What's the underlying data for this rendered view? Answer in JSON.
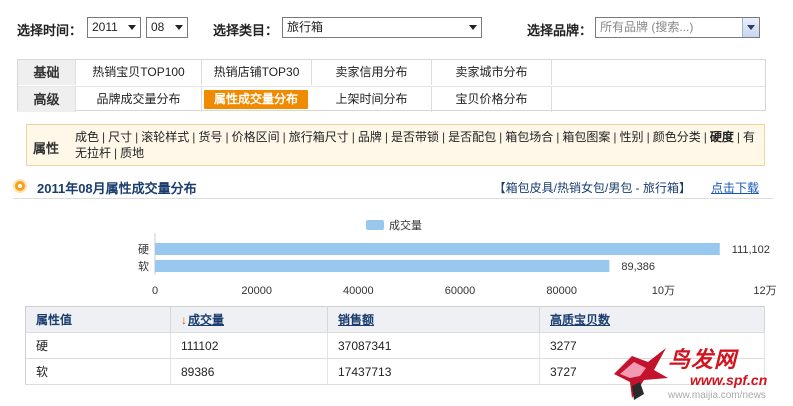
{
  "filters": {
    "time_label": "选择时间：",
    "year": "2011",
    "month": "08",
    "category_label": "选择类目：",
    "category": "旅行箱",
    "brand_label": "选择品牌：",
    "brand_placeholder": "所有品牌 (搜索...)"
  },
  "nav": {
    "basic_label": "基础",
    "basic_items": [
      "热销宝贝TOP100",
      "热销店铺TOP30",
      "卖家信用分布",
      "卖家城市分布"
    ],
    "advanced_label": "高级",
    "advanced_items": [
      "品牌成交量分布",
      "属性成交量分布",
      "上架时间分布",
      "宝贝价格分布"
    ],
    "active_advanced_index": 1
  },
  "attributes": {
    "label": "属性",
    "items": [
      "成色",
      "尺寸",
      "滚轮样式",
      "货号",
      "价格区间",
      "旅行箱尺寸",
      "品牌",
      "是否带锁",
      "是否配包",
      "箱包场合",
      "箱包图案",
      "性别",
      "颜色分类",
      "硬度",
      "有无拉杆",
      "质地"
    ],
    "current": "硬度"
  },
  "section": {
    "title": "2011年08月属性成交量分布",
    "category_path": "【箱包皮具/热销女包/男包 - 旅行箱】",
    "download_link": "点击下载"
  },
  "chart_data": {
    "type": "bar",
    "orientation": "horizontal",
    "categories": [
      "硬",
      "软"
    ],
    "series": [
      {
        "name": "成交量",
        "values": [
          111102,
          89386
        ]
      }
    ],
    "data_labels": [
      "111,102",
      "89,386"
    ],
    "xlim": [
      0,
      120000
    ],
    "x_ticks": [
      "0",
      "20000",
      "40000",
      "60000",
      "80000",
      "10万",
      "12万"
    ],
    "legend_position": "top-center",
    "grid": false,
    "bar_color": "#99c8ef"
  },
  "table": {
    "headers": [
      "属性值",
      "成交量",
      "销售额",
      "高质宝贝数"
    ],
    "sort_arrow": "↓",
    "rows": [
      [
        "硬",
        "111102",
        "37087341",
        "3277"
      ],
      [
        "软",
        "89386",
        "17437713",
        "3727"
      ]
    ]
  },
  "watermark": {
    "logo": "鸟发网",
    "site": "www.spf.cn",
    "url": "www.maijia.com/news"
  }
}
